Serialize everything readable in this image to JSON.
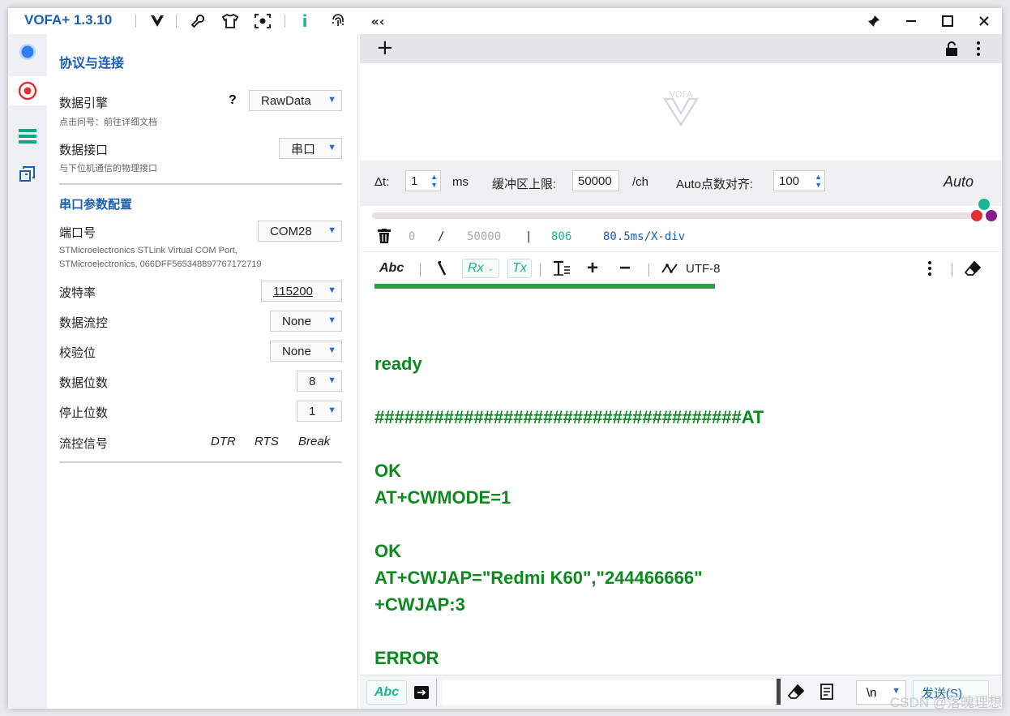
{
  "app": {
    "title": "VOFA+ 1.3.10"
  },
  "panel": {
    "section1_title": "协议与连接",
    "engine_label": "数据引擎",
    "engine_help": "?",
    "engine_value": "RawData",
    "engine_desc": "点击问号：前往详细文档",
    "interface_label": "数据接口",
    "interface_value": "串口",
    "interface_desc": "与下位机通信的物理接口",
    "section2_title": "串口参数配置",
    "port_label": "端口号",
    "port_value": "COM28",
    "port_desc1": "STMicroelectronics STLink Virtual COM Port,",
    "port_desc2": "STMicroelectronics, 066DFF565348897767172719",
    "baud_label": "波特率",
    "baud_value": "115200",
    "flow_label": "数据流控",
    "flow_value": "None",
    "parity_label": "校验位",
    "parity_value": "None",
    "databits_label": "数据位数",
    "databits_value": "8",
    "stopbits_label": "停止位数",
    "stopbits_value": "1",
    "signal_label": "流控信号",
    "dtr": "DTR",
    "rts": "RTS",
    "break": "Break"
  },
  "controls": {
    "dt_label": "Δt:",
    "dt_value": "1",
    "dt_unit": "ms",
    "buffer_label": "缓冲区上限:",
    "buffer_value": "50000",
    "buffer_unit": "/ch",
    "auto_align_label": "Auto点数对齐:",
    "auto_align_value": "100",
    "auto_label": "Auto"
  },
  "stats": {
    "current": "0",
    "slash": "/",
    "max": "50000",
    "bar": "|",
    "count": "806",
    "rate": "80.5ms/X-div"
  },
  "toolbar": {
    "abc": "Abc",
    "rx": "Rx",
    "tx": "Tx",
    "encoding": "UTF-8"
  },
  "terminal": {
    "lines": [
      "ready",
      "#####################################AT",
      "OK",
      "AT+CWMODE=1",
      "OK",
      "AT+CWJAP=\"Redmi K60\",\"244466666\"",
      "+CWJAP:3",
      "ERROR"
    ]
  },
  "sendbar": {
    "abc": "Abc",
    "newline": "\\n",
    "send_label": "发送(S)"
  },
  "watermark": "CSDN @落魄理想",
  "colors": {
    "accent": "#1a5fb4",
    "terminal_text": "#0d8a1f",
    "teal": "#1ab394"
  }
}
